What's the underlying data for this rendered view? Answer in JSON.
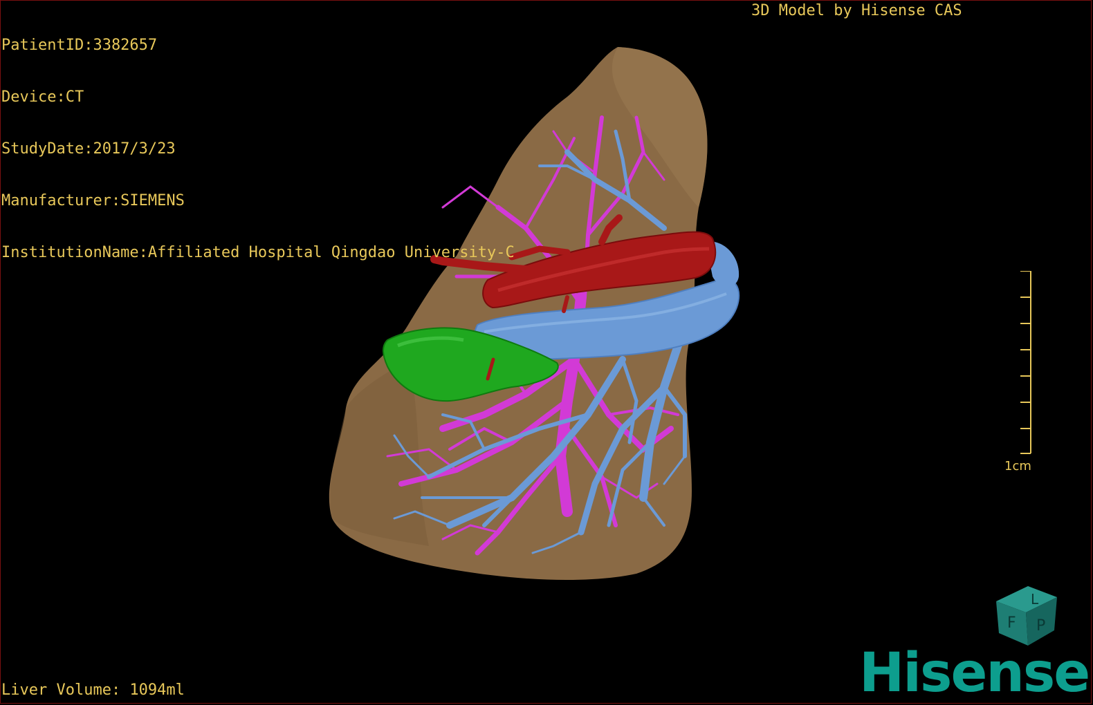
{
  "info": {
    "patient_id": "PatientID:3382657",
    "device": "Device:CT",
    "study_date": "StudyDate:2017/3/23",
    "manufacturer": "Manufacturer:SIEMENS",
    "institution": "InstitutionName:Affiliated Hospital Qingdao University-C"
  },
  "credit": "3D Model by Hisense CAS",
  "volume": "Liver Volume: 1094ml",
  "scale": {
    "label": "1cm"
  },
  "cube": {
    "labels": [
      "F",
      "L",
      "P"
    ]
  },
  "logo": "Hisense",
  "colors": {
    "text": "#e8c85a",
    "liver": "#8a6a45",
    "hepatic_vein": "#6b9ad6",
    "portal_vein": "#d23ad6",
    "ivc": "#a81818",
    "gallbladder": "#1fa81f",
    "brand": "#0d9e8e"
  }
}
